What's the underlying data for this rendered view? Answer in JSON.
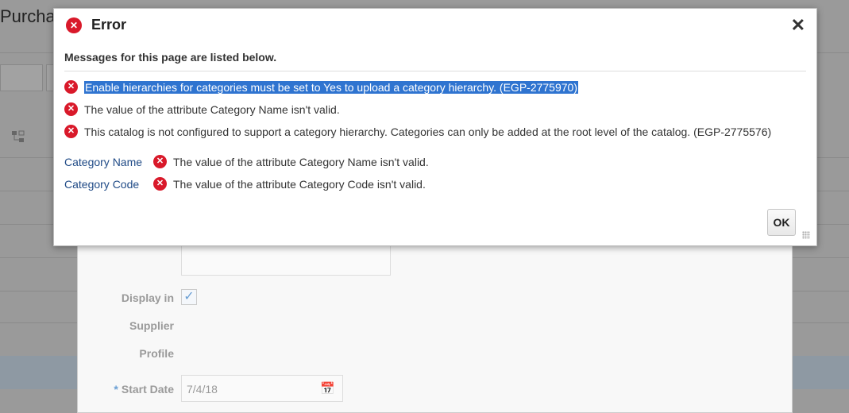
{
  "background": {
    "page_title": "Purcha",
    "display_in_label": "Display in",
    "supplier_label": "Supplier",
    "profile_label": "Profile",
    "required_mark": "*",
    "start_date_label": "Start Date",
    "start_date_value": "7/4/18",
    "display_in_checked": true
  },
  "dialog": {
    "title": "Error",
    "close_label": "✕",
    "subtitle": "Messages for this page are listed below.",
    "messages": [
      "Enable hierarchies for categories must be set to Yes to upload a category hierarchy. (EGP-2775970)",
      "The value of the attribute Category Name isn't valid.",
      "This catalog is not configured to support a category hierarchy. Categories can only be added at the root level of the catalog. (EGP-2775576)"
    ],
    "field_errors": [
      {
        "field": "Category Name",
        "message": "The value of the attribute Category Name isn't valid."
      },
      {
        "field": "Category Code",
        "message": "The value of the attribute Category Code isn't valid."
      }
    ],
    "ok_label": "OK"
  },
  "colors": {
    "error": "#d9192a",
    "link": "#1f4a86",
    "selection": "#2f74d0"
  }
}
